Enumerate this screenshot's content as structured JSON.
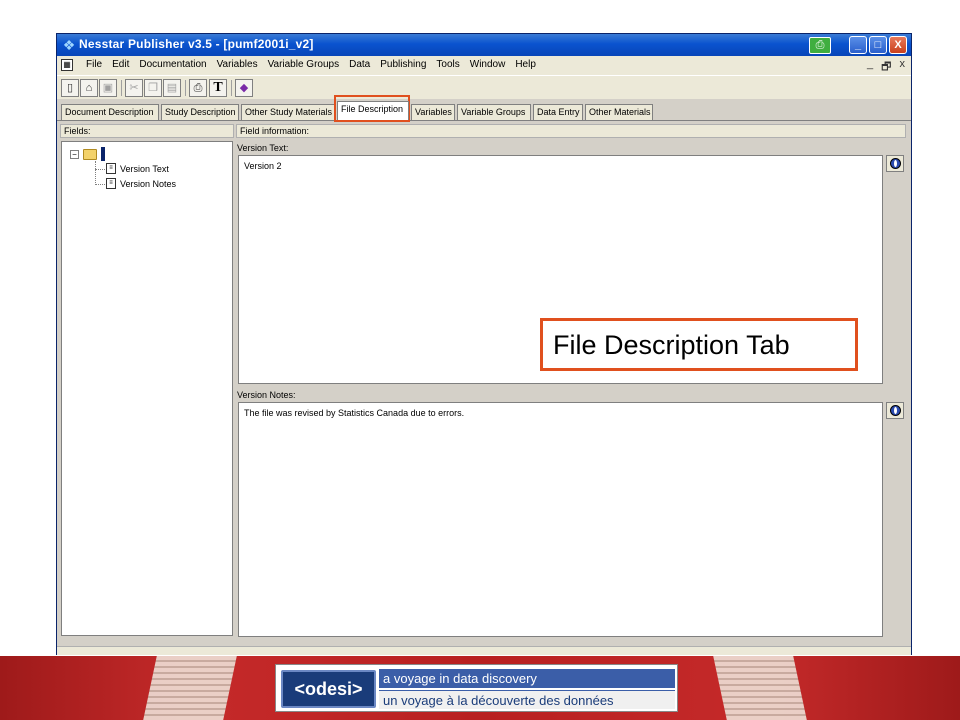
{
  "window": {
    "title": "Nesstar Publisher v3.5 - [pumf2001i_v2]",
    "controls": {
      "minimize": "_",
      "maximize": "□",
      "close": "X"
    }
  },
  "menu": {
    "items": [
      "File",
      "Edit",
      "Documentation",
      "Variables",
      "Variable Groups",
      "Data",
      "Publishing",
      "Tools",
      "Window",
      "Help"
    ],
    "mdi": {
      "minimize": "_",
      "restore": "🗗",
      "close": "x"
    }
  },
  "toolbar": {
    "text_tool": "T"
  },
  "tabs": [
    {
      "label": "Document Description"
    },
    {
      "label": "Study Description"
    },
    {
      "label": "Other Study Materials"
    },
    {
      "label": "File Description",
      "active": true
    },
    {
      "label": "Variables"
    },
    {
      "label": "Variable Groups"
    },
    {
      "label": "Data Entry"
    },
    {
      "label": "Other Materials"
    }
  ],
  "fields_panel": {
    "header": "Fields:",
    "tree": [
      "Version Text",
      "Version Notes"
    ]
  },
  "info_panel": {
    "header": "Field information:",
    "version_text_label": "Version Text:",
    "version_text_value": "Version 2",
    "version_notes_label": "Version Notes:",
    "version_notes_value": "The file was revised by Statistics Canada due to errors."
  },
  "callout": {
    "text": "File Description Tab"
  },
  "banner": {
    "logo": "<odesi>",
    "tagline_en": "a voyage in data discovery",
    "tagline_fr": "un voyage à la découverte des données"
  },
  "colors": {
    "titlebar": "#0a53cf",
    "highlight": "#e0501e",
    "banner": "#c52a2a",
    "logo": "#1a3c7a"
  },
  "icons": [
    "app-icon",
    "printer-icon",
    "new-file-icon",
    "open-folder-icon",
    "save-icon",
    "cut-icon",
    "copy-icon",
    "paste-icon",
    "print-icon",
    "text-icon",
    "book-icon",
    "folder-icon",
    "document-icon",
    "globe-help-icon"
  ]
}
